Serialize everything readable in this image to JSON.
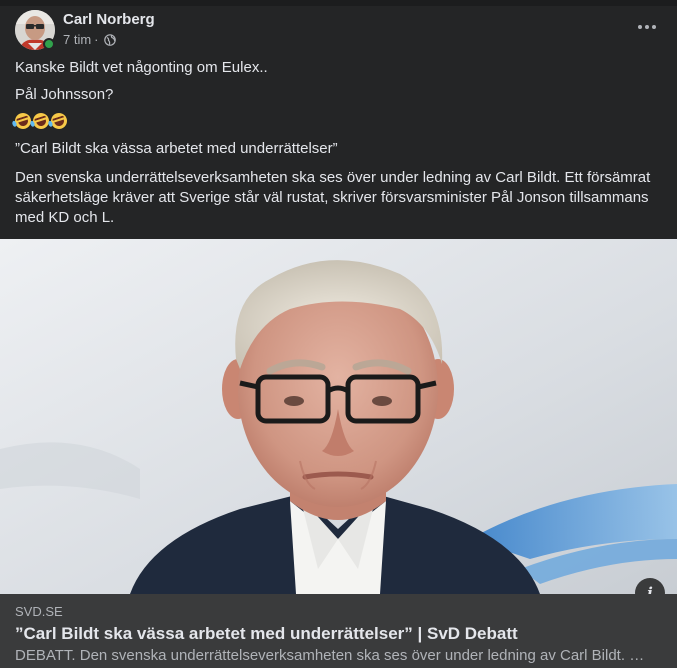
{
  "post": {
    "author": "Carl Norberg",
    "time": "7 tim",
    "separator": "·",
    "audience_icon": "globe-icon",
    "online_color": "#31a24c",
    "lines": [
      "Kanske Bildt vet någonting om Eulex..",
      "Pål Johnsson?",
      "”Carl Bildt ska vässa arbetet med underrättelser”",
      "Den svenska underrättelseverksamheten ska ses över under ledning av Carl Bildt. Ett försämrat säkerhetsläge kräver att Sverige står väl rustat, skriver försvarsminister Pål Jonson tillsammans med KD och L."
    ],
    "emojis": [
      "rolling-on-floor-laughing",
      "rolling-on-floor-laughing",
      "rolling-on-floor-laughing"
    ]
  },
  "link_preview": {
    "domain": "SVD.SE",
    "title": "”Carl Bildt ska vässa arbetet med underrättelser” | SvD Debatt",
    "description": "DEBATT. Den svenska underrättelseverksamheten ska ses över under ledning av Carl Bildt. Ett försämrat säkerhetsläge kräver att Sverige står väl rustat, skriver försvarsminister Pål Jonson tillsammans med KD och L."
  },
  "info_button_label": "i",
  "colors": {
    "background": "#242526",
    "link_box": "#3a3b3c",
    "text_primary": "#e4e6eb",
    "text_secondary": "#b0b3b8"
  }
}
